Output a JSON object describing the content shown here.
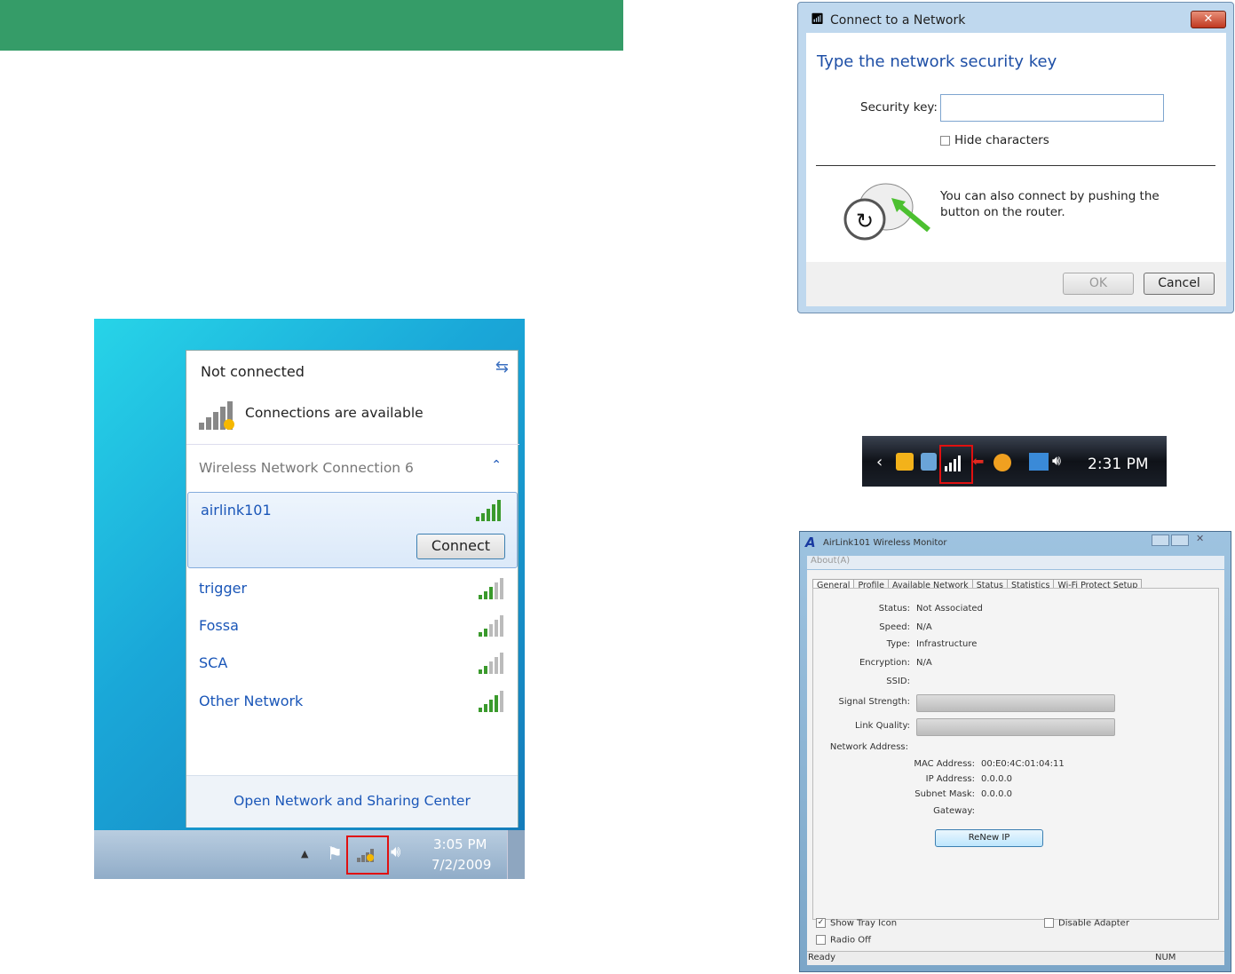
{
  "win7_popup": {
    "status": "Not connected",
    "available": "Connections are available",
    "section": "Wireless Network Connection 6",
    "networks": [
      {
        "name": "airlink101",
        "signal": 5,
        "selected": true
      },
      {
        "name": "trigger",
        "signal": 3
      },
      {
        "name": "Fossa",
        "signal": 2
      },
      {
        "name": "SCA",
        "signal": 2
      },
      {
        "name": "Other Network",
        "signal": 4
      }
    ],
    "connect_label": "Connect",
    "footer_link": "Open Network and Sharing Center",
    "time": "3:05 PM",
    "date": "7/2/2009"
  },
  "connect_dialog": {
    "title": "Connect to a Network",
    "heading": "Type the network security key",
    "security_key_label": "Security key:",
    "security_key_value": "",
    "hide_characters": "Hide characters",
    "wps_text": "You can also connect by pushing the button on the router.",
    "ok": "OK",
    "cancel": "Cancel"
  },
  "vista_taskbar": {
    "time": "2:31 PM"
  },
  "airlink_monitor": {
    "title": "AirLink101 Wireless Monitor",
    "menu": "About(A)",
    "tabs": [
      "General",
      "Profile",
      "Available Network",
      "Status",
      "Statistics",
      "Wi-Fi Protect Setup"
    ],
    "fields": [
      {
        "label": "Status:",
        "value": "Not Associated"
      },
      {
        "label": "Speed:",
        "value": "N/A"
      },
      {
        "label": "Type:",
        "value": "Infrastructure"
      },
      {
        "label": "Encryption:",
        "value": "N/A"
      },
      {
        "label": "SSID:",
        "value": ""
      }
    ],
    "signal_label": "Signal Strength:",
    "signal_value": 0,
    "link_label": "Link Quality:",
    "link_value": 0,
    "network_address": "Network Address:",
    "addr": [
      {
        "label": "MAC Address:",
        "value": "00:E0:4C:01:04:11"
      },
      {
        "label": "IP Address:",
        "value": "0.0.0.0"
      },
      {
        "label": "Subnet Mask:",
        "value": "0.0.0.0"
      },
      {
        "label": "Gateway:",
        "value": ""
      }
    ],
    "renew": "ReNew IP",
    "show_tray": "Show Tray Icon",
    "disable_adapter": "Disable Adapter",
    "radio_off": "Radio Off",
    "status_left": "Ready",
    "status_right": "NUM"
  }
}
